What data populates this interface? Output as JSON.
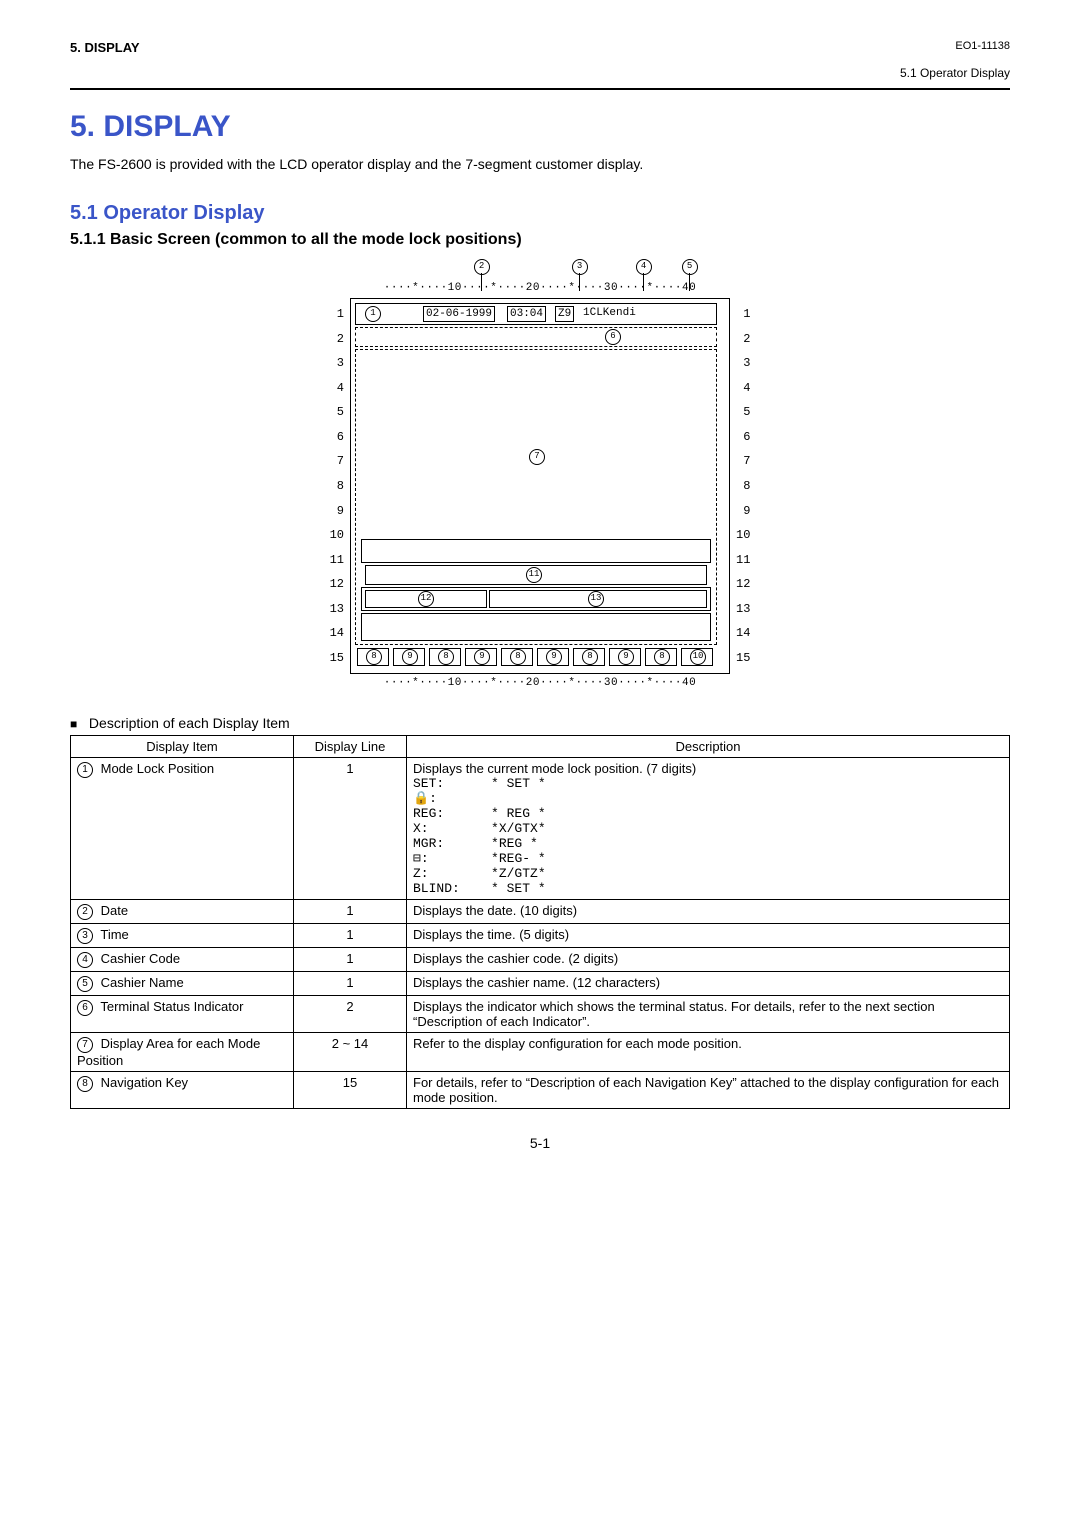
{
  "header": {
    "left": "5.   DISPLAY",
    "right_top": "EO1-11138",
    "right_sub": "5.1  Operator Display"
  },
  "title": "5.    DISPLAY",
  "intro": "The FS-2600 is provided with the LCD operator display and the 7-segment customer display.",
  "sub_title": "5.1     Operator Display",
  "subsub_title": "5.1.1    Basic Screen (common to all the mode lock positions)",
  "figure": {
    "ruler": "····*····10····*····20····*····30····*····40",
    "line_numbers": [
      "1",
      "2",
      "3",
      "4",
      "5",
      "6",
      "7",
      "8",
      "9",
      "10",
      "11",
      "12",
      "13",
      "14",
      "15"
    ],
    "row1": {
      "date": "02-06-1999",
      "time": "03:04",
      "code": "Z9",
      "name": "1CLKendi"
    },
    "callouts_top": [
      "2",
      "3",
      "4",
      "5"
    ],
    "inner_labels": {
      "c1": "1",
      "c6": "6",
      "c7": "7",
      "c11": "11",
      "c12": "12",
      "c13": "13",
      "c8": "8",
      "c9": "9",
      "c10": "10"
    }
  },
  "desc_head": "Description of each Display Item",
  "table": {
    "headers": [
      "Display Item",
      "Display Line",
      "Description"
    ],
    "rows": [
      {
        "num": "1",
        "item": "Mode Lock Position",
        "line": "1",
        "desc_intro": "Displays the current mode lock position. (7 digits)",
        "modes": [
          [
            "SET:",
            "* SET *"
          ],
          [
            "🔒:",
            ""
          ],
          [
            "REG:",
            "* REG *"
          ],
          [
            "X:",
            "*X/GTX*"
          ],
          [
            "MGR:",
            "*REG *"
          ],
          [
            "⊟:",
            "*REG- *"
          ],
          [
            "Z:",
            "*Z/GTZ*"
          ],
          [
            "BLIND:",
            "* SET *"
          ]
        ]
      },
      {
        "num": "2",
        "item": "Date",
        "line": "1",
        "desc": "Displays the date. (10 digits)"
      },
      {
        "num": "3",
        "item": "Time",
        "line": "1",
        "desc": "Displays the time. (5 digits)"
      },
      {
        "num": "4",
        "item": "Cashier Code",
        "line": "1",
        "desc": "Displays the cashier code. (2 digits)"
      },
      {
        "num": "5",
        "item": "Cashier Name",
        "line": "1",
        "desc": "Displays the cashier name. (12 characters)"
      },
      {
        "num": "6",
        "item": "Terminal Status Indicator",
        "line": "2",
        "desc": "Displays the indicator which shows the terminal status. For details, refer to the next section “Description of each Indicator”."
      },
      {
        "num": "7",
        "item": "Display Area for each Mode Position",
        "line": "2 ~ 14",
        "desc": "Refer to the display configuration for each mode position."
      },
      {
        "num": "8",
        "item": "Navigation Key",
        "line": "15",
        "desc": "For details, refer to “Description of each Navigation Key” attached to the display configuration for each mode position."
      }
    ]
  },
  "page_num": "5-1"
}
